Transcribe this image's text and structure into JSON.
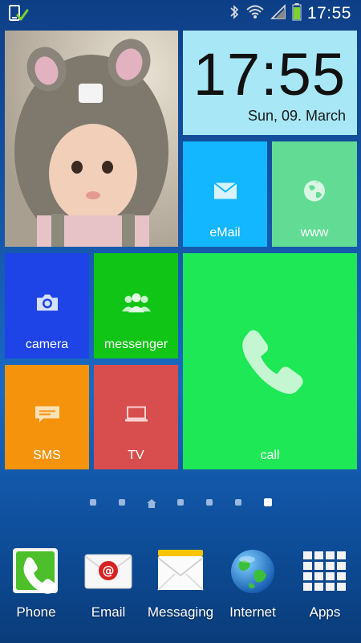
{
  "status_bar": {
    "time": "17:55",
    "icons": [
      "usb-debug-icon",
      "bluetooth-icon",
      "wifi-icon",
      "signal-icon",
      "battery-icon"
    ],
    "battery_color": "#7bd230"
  },
  "tiles": {
    "photo": {
      "description_icon": "baby-photo"
    },
    "clock": {
      "time": "17:55",
      "date": "Sun, 09. March"
    },
    "email": {
      "label": "eMail",
      "icon": "envelope-icon",
      "color": "#12b7ff"
    },
    "www": {
      "label": "www",
      "icon": "globe-icon",
      "color": "#62dc95"
    },
    "camera": {
      "label": "camera",
      "icon": "camera-icon",
      "color": "#1e44e8"
    },
    "messenger": {
      "label": "messenger",
      "icon": "people-icon",
      "color": "#11c517"
    },
    "call": {
      "label": "call",
      "icon": "phone-handset-icon",
      "color": "#1ee855"
    },
    "sms": {
      "label": "SMS",
      "icon": "sms-bubble-icon",
      "color": "#f5940c"
    },
    "tv": {
      "label": "TV",
      "icon": "tv-icon",
      "color": "#d84e4e"
    }
  },
  "pager": {
    "page_count": 7,
    "home_index": 2,
    "active_index": 6
  },
  "dock": [
    {
      "label": "Phone",
      "icon": "phone-app-icon"
    },
    {
      "label": "Email",
      "icon": "email-app-icon"
    },
    {
      "label": "Messaging",
      "icon": "messaging-app-icon"
    },
    {
      "label": "Internet",
      "icon": "internet-app-icon"
    },
    {
      "label": "Apps",
      "icon": "apps-grid-icon"
    }
  ]
}
